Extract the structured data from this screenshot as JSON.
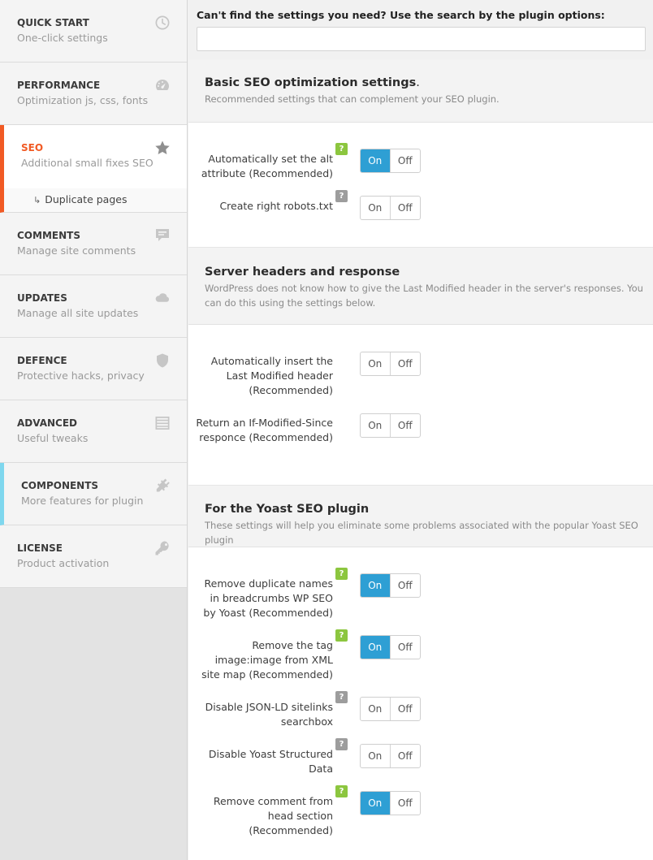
{
  "sidebar": {
    "items": [
      {
        "title": "QUICK START",
        "desc": "One-click settings",
        "icon": "clock-icon"
      },
      {
        "title": "PERFORMANCE",
        "desc": "Optimization js, css, fonts",
        "icon": "speedometer-icon"
      },
      {
        "title": "SEO",
        "desc": "Additional small fixes SEO",
        "icon": "star-icon"
      },
      {
        "title": "COMMENTS",
        "desc": "Manage site comments",
        "icon": "comment-icon"
      },
      {
        "title": "UPDATES",
        "desc": "Manage all site updates",
        "icon": "cloud-icon"
      },
      {
        "title": "DEFENCE",
        "desc": "Protective hacks, privacy",
        "icon": "shield-icon"
      },
      {
        "title": "ADVANCED",
        "desc": "Useful tweaks",
        "icon": "list-icon"
      },
      {
        "title": "COMPONENTS",
        "desc": "More features for plugin",
        "icon": "plug-icon"
      },
      {
        "title": "LICENSE",
        "desc": "Product activation",
        "icon": "key-icon"
      }
    ],
    "subitem": {
      "arrow": "↳",
      "label": "Duplicate pages"
    }
  },
  "search": {
    "label": "Can't find the settings you need? Use the search by the plugin options:",
    "value": "",
    "placeholder": ""
  },
  "sections": [
    {
      "title": "Basic SEO optimization settings",
      "title_suffix": ".",
      "desc": "Recommended settings that can complement your SEO plugin.",
      "options": [
        {
          "label": "Automatically set the alt attribute (Recommended)",
          "help": "?",
          "help_color": "green",
          "state": "On"
        },
        {
          "label": "Create right robots.txt",
          "help": "?",
          "help_color": "grey",
          "state": "Off"
        }
      ]
    },
    {
      "title": "Server headers and response",
      "title_suffix": "",
      "desc": "WordPress does not know how to give the Last Modified header in the server's responses. You can do this using the settings below.",
      "options": [
        {
          "label": "Automatically insert the Last Modified header (Recommended)",
          "help": "",
          "help_color": "",
          "state": "Off"
        },
        {
          "label": "Return an If-Modified-Since responce (Recommended)",
          "help": "",
          "help_color": "",
          "state": "Off"
        }
      ]
    },
    {
      "title": "For the Yoast SEO plugin",
      "title_suffix": "",
      "desc": "These settings will help you eliminate some problems associated with the popular Yoast SEO plugin",
      "options": [
        {
          "label": "Remove duplicate names in breadcrumbs WP SEO by Yoast (Recommended)",
          "help": "?",
          "help_color": "green",
          "state": "On"
        },
        {
          "label": "Remove the tag image:image from XML site map (Recommended)",
          "help": "?",
          "help_color": "green",
          "state": "On"
        },
        {
          "label": "Disable JSON-LD sitelinks searchbox",
          "help": "?",
          "help_color": "grey",
          "state": "Off"
        },
        {
          "label": "Disable Yoast Structured Data",
          "help": "?",
          "help_color": "grey",
          "state": "Off"
        },
        {
          "label": "Remove comment from head section (Recommended)",
          "help": "?",
          "help_color": "green",
          "state": "On"
        }
      ]
    }
  ],
  "toggle": {
    "on_label": "On",
    "off_label": "Off"
  },
  "colors": {
    "accent_active": "#f15a24",
    "components_marker": "#7fd7ee",
    "toggle_on": "#2e9fd4",
    "help_green": "#8cc63f",
    "help_grey": "#9d9d9d"
  }
}
